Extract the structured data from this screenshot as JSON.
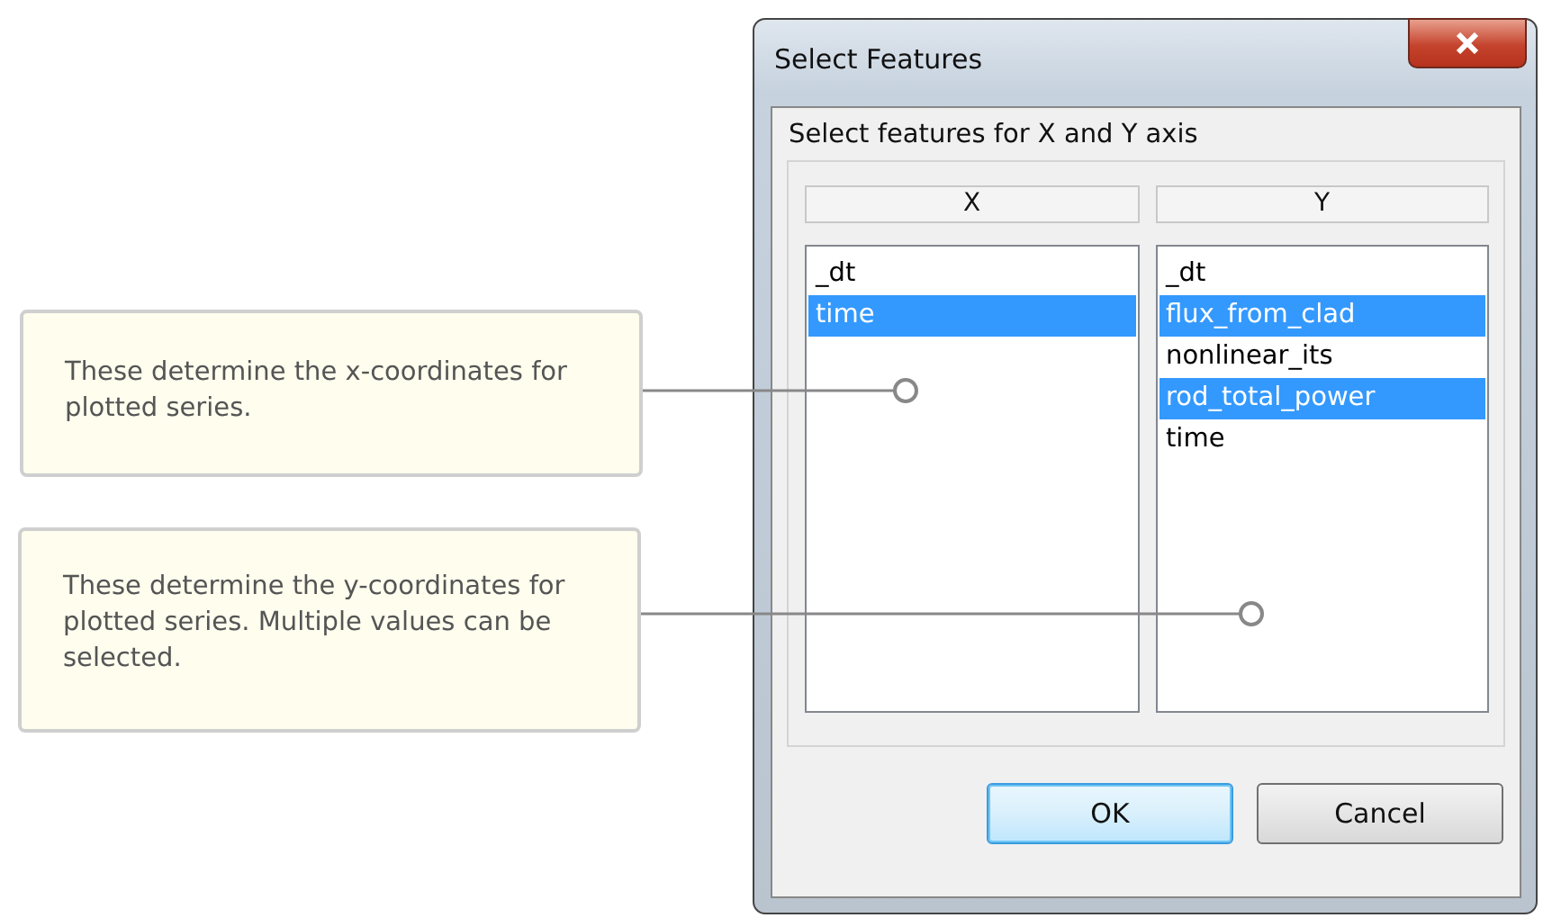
{
  "callouts": [
    {
      "text": "These determine the x-coordinates for plotted series."
    },
    {
      "text": "These determine the y-coordinates for plotted series. Multiple values can be selected."
    }
  ],
  "dialog": {
    "title": "Select Features",
    "group_label": "Select features for X and Y axis",
    "columns": [
      {
        "header": "X",
        "items": [
          {
            "label": "_dt",
            "selected": false
          },
          {
            "label": "time",
            "selected": true
          }
        ]
      },
      {
        "header": "Y",
        "items": [
          {
            "label": "_dt",
            "selected": false
          },
          {
            "label": "flux_from_clad",
            "selected": true
          },
          {
            "label": "nonlinear_its",
            "selected": false
          },
          {
            "label": "rod_total_power",
            "selected": true
          },
          {
            "label": "time",
            "selected": false
          }
        ]
      }
    ],
    "buttons": [
      {
        "label": "OK",
        "kind": "default"
      },
      {
        "label": "Cancel",
        "kind": "normal"
      }
    ]
  }
}
